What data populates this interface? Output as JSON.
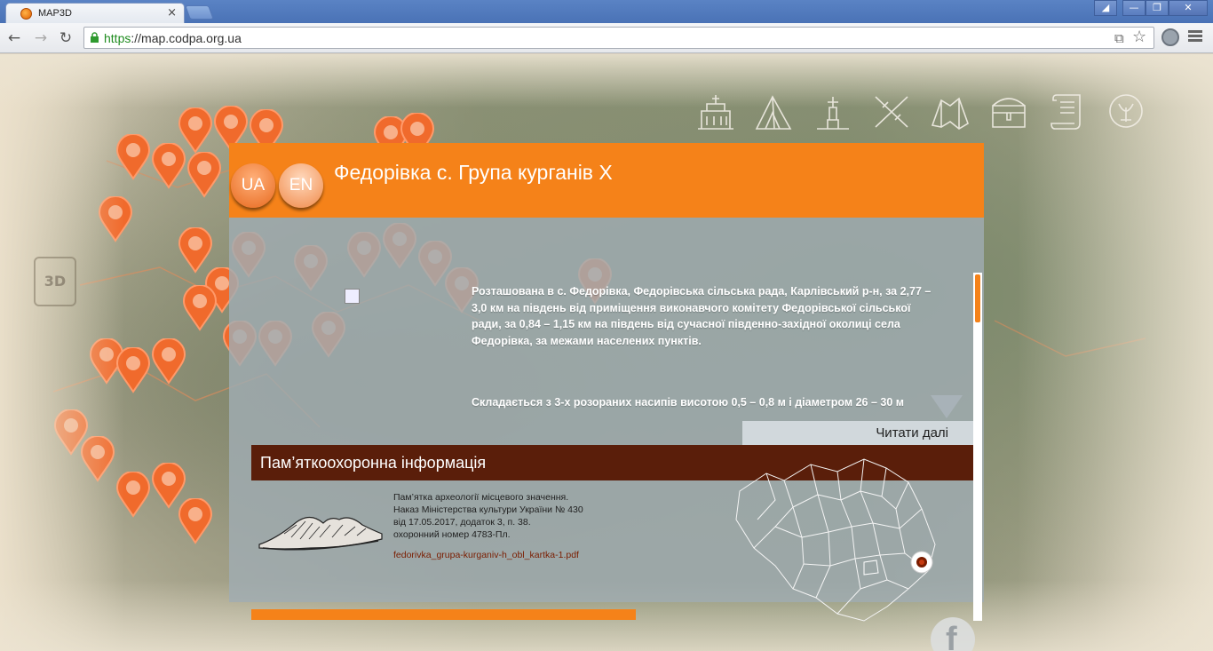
{
  "browser": {
    "tab_title": "MAP3D",
    "tab_close": "×",
    "url_protocol": "https",
    "url_rest": "://map.codpa.org.ua",
    "window_buttons": [
      "◢",
      "—",
      "❐",
      "✕"
    ]
  },
  "nav": {
    "back": "←",
    "forward": "→",
    "reload": "↻",
    "translate": "⧉",
    "star": "☆"
  },
  "map": {
    "badge_3d": "3D"
  },
  "categories": [
    "building-icon",
    "tent-icon",
    "monument-icon",
    "weapons-icon",
    "map-scroll-icon",
    "chest-icon",
    "scroll-icon",
    "emblem-icon"
  ],
  "panel": {
    "lang_ua": "UA",
    "lang_en": "EN",
    "title": "Федорівка с. Група курганів Х",
    "description": "Розташована в с. Федорівка, Федорівська сільська рада, Карлівський р-н, за 2,77 – 3,0 км на південь від приміщення виконавчого комітету Федорівської сільської ради, за 0,84 – 1,15 км на південь від сучасної південно-західної околиці села Федорівка, за межами населених пунктів.",
    "description2": "Складається з 3-х розораних насипів висотою 0,5 – 0,8 м і діаметром 26 – 30 м",
    "read_more": "Читати далі",
    "section_title": "Пам’яткоохоронна інформація",
    "protection_line1": "Пам’ятка археології місцевого значення.",
    "protection_line2": "Наказ Міністерства культури України № 430",
    "protection_line3": "від 17.05.2017, додаток 3, п. 38.",
    "protection_line4": "охоронний номер 4783-Пл.",
    "pdf_link": "fedorivka_grupa-kurganiv-h_obl_kartka-1.pdf",
    "facebook": "f"
  },
  "colors": {
    "accent": "#f58219",
    "section": "#5a1e0a",
    "pin": "#f06a2c"
  }
}
